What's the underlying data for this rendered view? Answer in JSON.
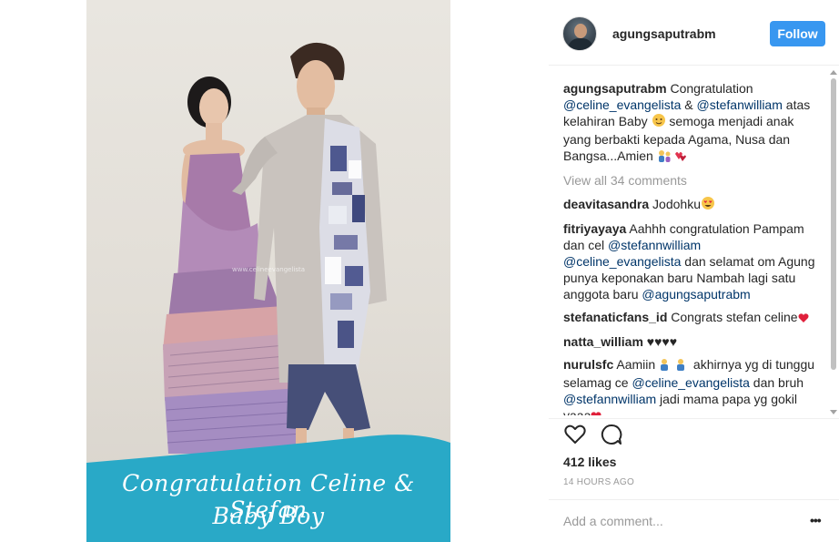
{
  "post": {
    "banner_line1": "Congratulation Celine & Stefan",
    "banner_line2": "Baby Boy",
    "watermark": "www.celineevangelista"
  },
  "header": {
    "username": "agungsaputrabm",
    "follow_label": "Follow"
  },
  "caption": {
    "user": "agungsaputrabm",
    "t1": " Congratulation ",
    "m1": "@celine_evangelista",
    "t2": " & ",
    "m2": "@stefanwilliam",
    "t3": " atas kelahiran Baby ",
    "t4": " semoga menjadi anak yang berbakti kepada Agama, Nusa dan Bangsa...Amien "
  },
  "view_all_label": "View all 34 comments",
  "comments": [
    {
      "user": "deavitasandra",
      "text": " Jodohku"
    },
    {
      "user": "fitriyayaya",
      "t1": " Aahhh congratulation Pampam dan cel ",
      "m1": "@stefannwilliam",
      "m2": "@celine_evangelista",
      "t2": " dan selamat om Agung punya keponakan baru Nambah lagi satu anggota baru ",
      "m3": "@agungsaputrabm"
    },
    {
      "user": "stefanaticfans_id",
      "text": " Congrats stefan celine"
    },
    {
      "user": "natta_william",
      "text": " ♥♥♥♥"
    },
    {
      "user": "nurulsfc",
      "t1": " Aamiin ",
      "t2": " akhirnya yg di tunggu selamag ce ",
      "m1": "@celine_evangelista",
      "t3": " dan bruh ",
      "m2": "@stefannwilliam",
      "t4": " jadi mama papa yg gokil yaaa"
    }
  ],
  "likes_label": "412 likes",
  "timestamp": "14 HOURS AGO",
  "add_comment_placeholder": "Add a comment...",
  "more_label": "•••",
  "colors": {
    "follow_bg": "#3897f0",
    "mention": "#003569",
    "banner": "#29a9c7",
    "muted": "#999999"
  },
  "icons": [
    "heart-icon",
    "comment-icon",
    "more-options-icon"
  ]
}
